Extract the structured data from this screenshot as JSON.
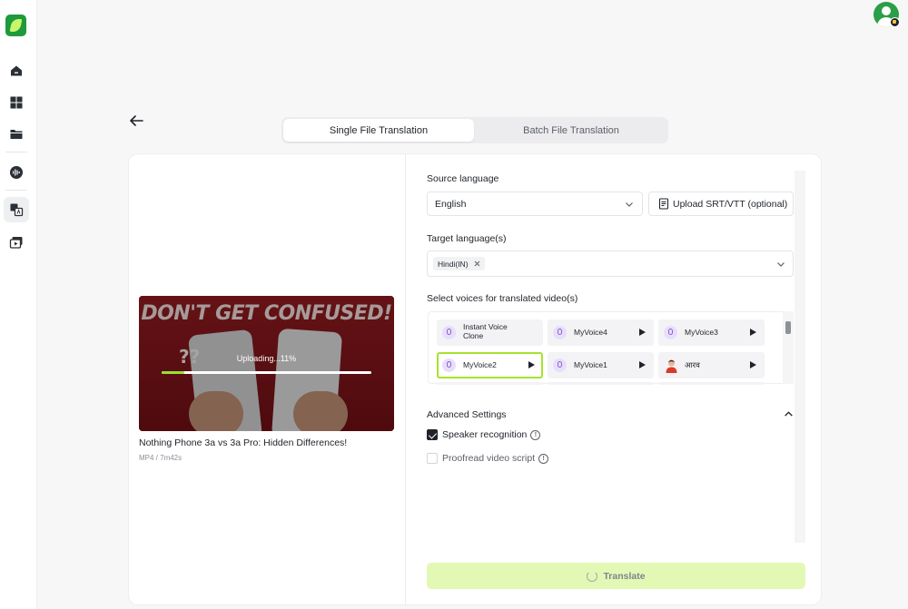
{
  "sidebar": {
    "items": [
      {
        "name": "home",
        "icon": "home-icon"
      },
      {
        "name": "dashboard",
        "icon": "grid-icon"
      },
      {
        "name": "files",
        "icon": "folder-icon"
      },
      {
        "name": "voice",
        "icon": "audio-wave-icon"
      },
      {
        "name": "translate",
        "icon": "translate-icon",
        "active": true
      },
      {
        "name": "video",
        "icon": "video-icon"
      }
    ]
  },
  "tabs": {
    "single": "Single File Translation",
    "batch": "Batch File Translation",
    "active": "single"
  },
  "video": {
    "thumbnail_text": "DON'T GET CONFUSED!",
    "thumbnail_marks": "??",
    "upload_status": "Uploading...11%",
    "upload_progress": 0.11,
    "title": "Nothing Phone 3a vs 3a Pro: Hidden Differences!",
    "meta": "MP4 / 7m42s"
  },
  "source": {
    "label": "Source language",
    "value": "English",
    "upload_label": "Upload SRT/VTT (optional)"
  },
  "target": {
    "label": "Target language(s)",
    "chips": [
      "Hindi(IN)"
    ]
  },
  "voices": {
    "label": "Select voices for translated video(s)",
    "items": [
      {
        "name": "Instant Voice Clone",
        "icon": "instant-clone-icon",
        "playable": false,
        "selected": false
      },
      {
        "name": "MyVoice4",
        "icon": "voice-lock-icon",
        "playable": true,
        "selected": false
      },
      {
        "name": "MyVoice3",
        "icon": "voice-lock-icon",
        "playable": true,
        "selected": false
      },
      {
        "name": "MyVoice2",
        "icon": "voice-lock-icon",
        "playable": true,
        "selected": true
      },
      {
        "name": "MyVoice1",
        "icon": "voice-lock-icon",
        "playable": true,
        "selected": false
      },
      {
        "name": "आरव",
        "icon": "avatar-icon",
        "playable": true,
        "selected": false
      }
    ]
  },
  "advanced": {
    "label": "Advanced Settings",
    "speaker_recognition": {
      "label": "Speaker recognition",
      "checked": true
    },
    "proofread": {
      "label": "Proofread video script",
      "checked": false
    }
  },
  "translate_button": {
    "label": "Translate",
    "loading": true
  },
  "colors": {
    "accent_green": "#a6e22e",
    "progress_green": "#9be02e",
    "translate_bg": "#e3f8b4",
    "brand": "#1e9a3d"
  }
}
